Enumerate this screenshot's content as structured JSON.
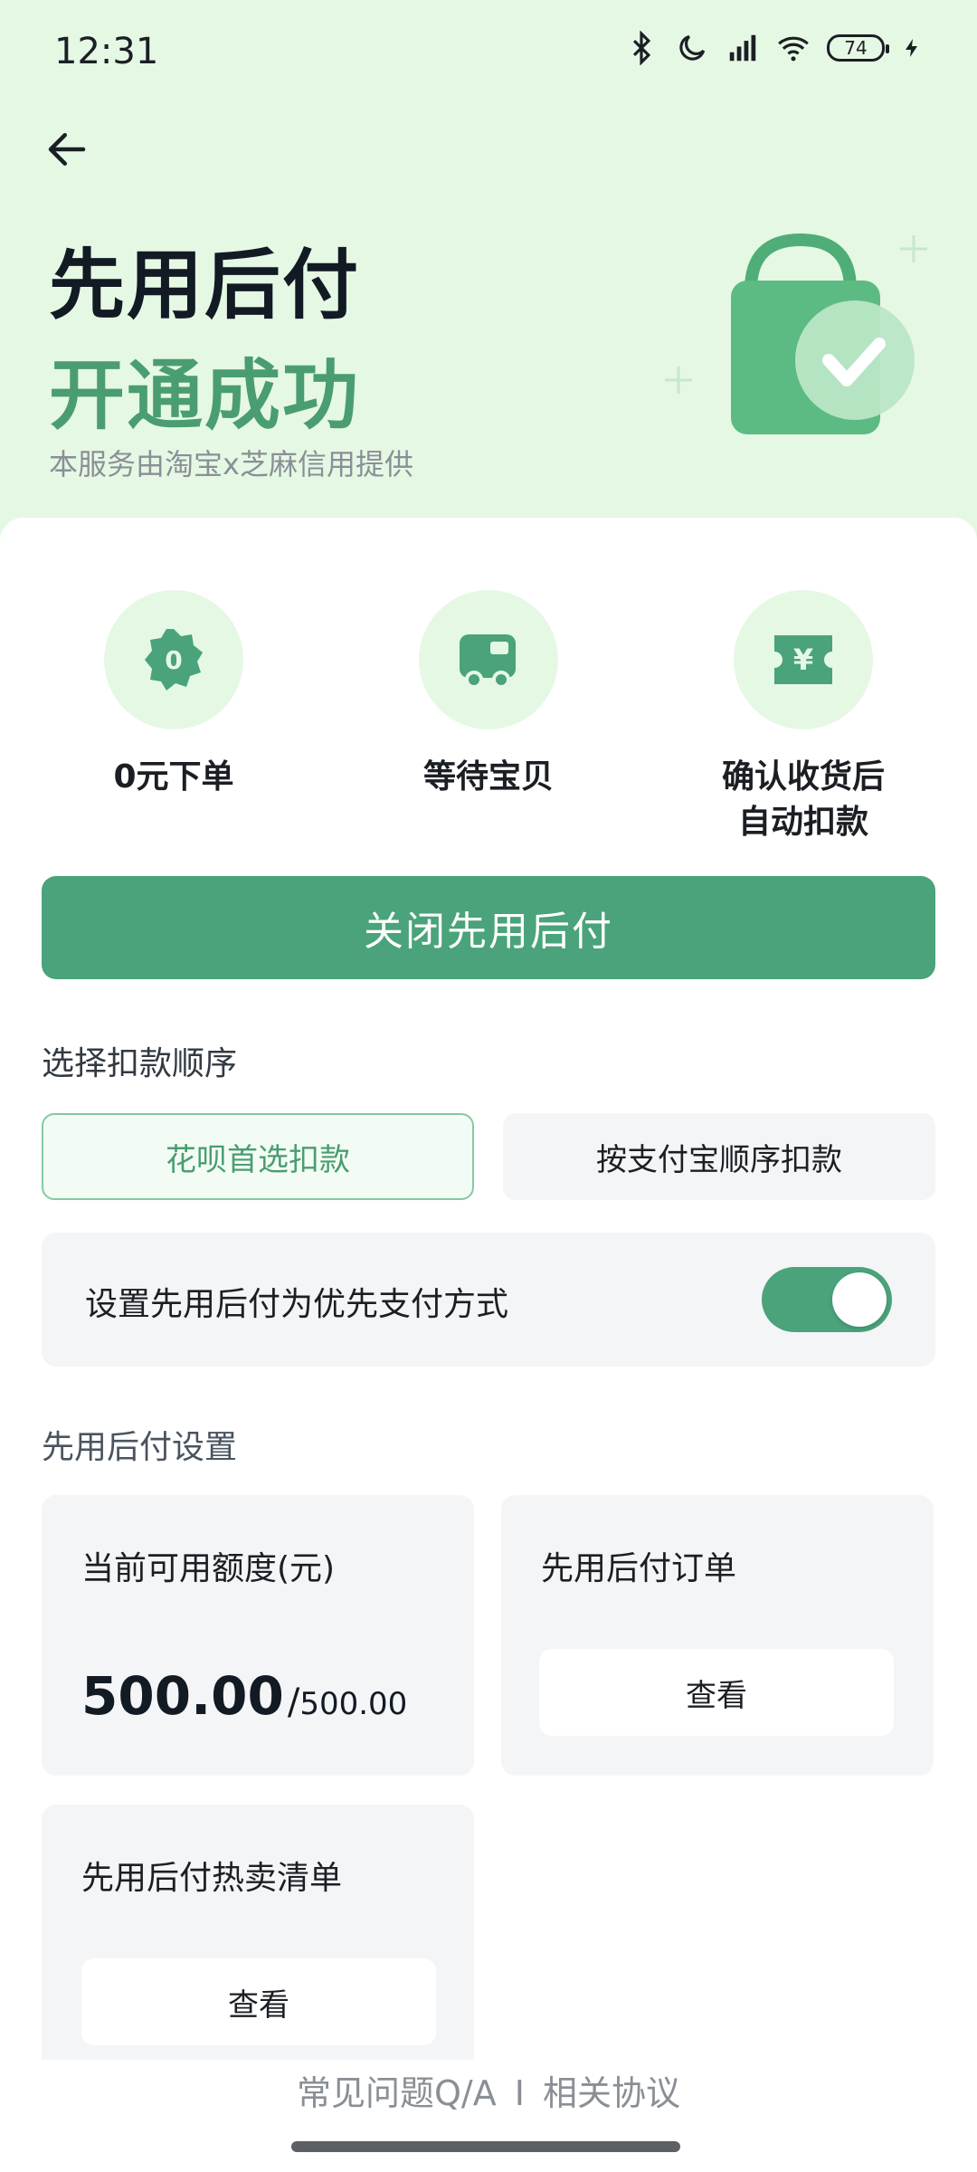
{
  "status_bar": {
    "time": "12:31",
    "battery": "74"
  },
  "header": {
    "title_line1": "先用后付",
    "title_line2": "开通成功",
    "subtitle": "本服务由淘宝x芝麻信用提供"
  },
  "steps": [
    {
      "label": "0元下单",
      "badge": "0"
    },
    {
      "label": "等待宝贝"
    },
    {
      "label": "确认收货后\n自动扣款",
      "badge": "¥"
    }
  ],
  "primary_button": {
    "label": "关闭先用后付"
  },
  "deduction_order": {
    "title": "选择扣款顺序",
    "options": [
      "花呗首选扣款",
      "按支付宝顺序扣款"
    ],
    "selected": "花呗首选扣款"
  },
  "priority_toggle": {
    "label": "设置先用后付为优先支付方式",
    "on": true
  },
  "settings": {
    "title": "先用后付设置",
    "quota": {
      "label": "当前可用额度(元)",
      "available": "500.00",
      "total": "500.00"
    },
    "orders": {
      "label": "先用后付订单",
      "button": "查看"
    },
    "hot_list": {
      "label": "先用后付热卖清单",
      "button": "查看"
    }
  },
  "footer": {
    "faq": "常见问题Q/A",
    "separator": "I",
    "agreement": "相关协议"
  },
  "colors": {
    "accent": "#4aa37a",
    "header_bg": "#e5f8e4",
    "tile_bg": "#f4f5f7"
  }
}
